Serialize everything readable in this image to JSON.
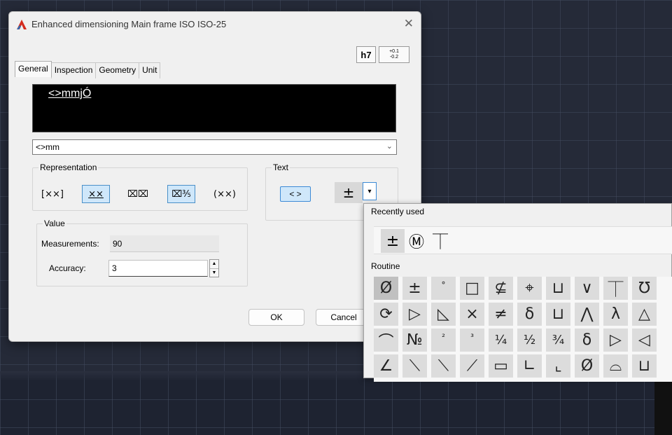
{
  "dialog": {
    "title": "Enhanced dimensioning Main frame ISO ISO-25",
    "close_glyph": "✕",
    "tol_btn_1": "h7",
    "tol_btn_2_top": "+0.1",
    "tol_btn_2_bottom": "-0.2",
    "tabs": [
      "General",
      "Inspection",
      "Geometry",
      "Unit"
    ],
    "preview_text": "<>mmjÓ",
    "combo_value": "<>mm",
    "combo_arrow": "⌄",
    "representation": {
      "title": "Representation",
      "buttons": [
        "[××]",
        "××",
        "⌧⌧",
        "⌧⅗",
        "(××)"
      ]
    },
    "text_group": {
      "title": "Text",
      "insert_label": "< >",
      "pm_label": "±",
      "dropdown_glyph": "▾"
    },
    "value": {
      "title": "Value",
      "measurements_label": "Measurements:",
      "measurements_value": "90",
      "accuracy_label": "Accuracy:",
      "accuracy_value": "3"
    },
    "ok_label": "OK",
    "cancel_label": "Cancel"
  },
  "symbols_popup": {
    "recently_used_label": "Recently used",
    "recent": [
      "±",
      "Ⓜ",
      "⏉"
    ],
    "routine_label": "Routine",
    "rows": [
      [
        "Ø",
        "±",
        "°",
        "□",
        "⊈",
        "⌖",
        "⊔",
        "∨",
        "⏉",
        "℧"
      ],
      [
        "⟳",
        "▷",
        "◺",
        "×",
        "≠",
        "δ",
        "⊔",
        "⋀",
        "λ",
        "△"
      ],
      [
        "⌒",
        "№",
        "²",
        "³",
        "¼",
        "½",
        "¾",
        "δ",
        "▷",
        "◁"
      ],
      [
        "∠",
        "⟍",
        "⟍",
        "⟋",
        "▭",
        "∟",
        "⌞",
        "Ø",
        "⌓",
        "⊔"
      ]
    ]
  }
}
